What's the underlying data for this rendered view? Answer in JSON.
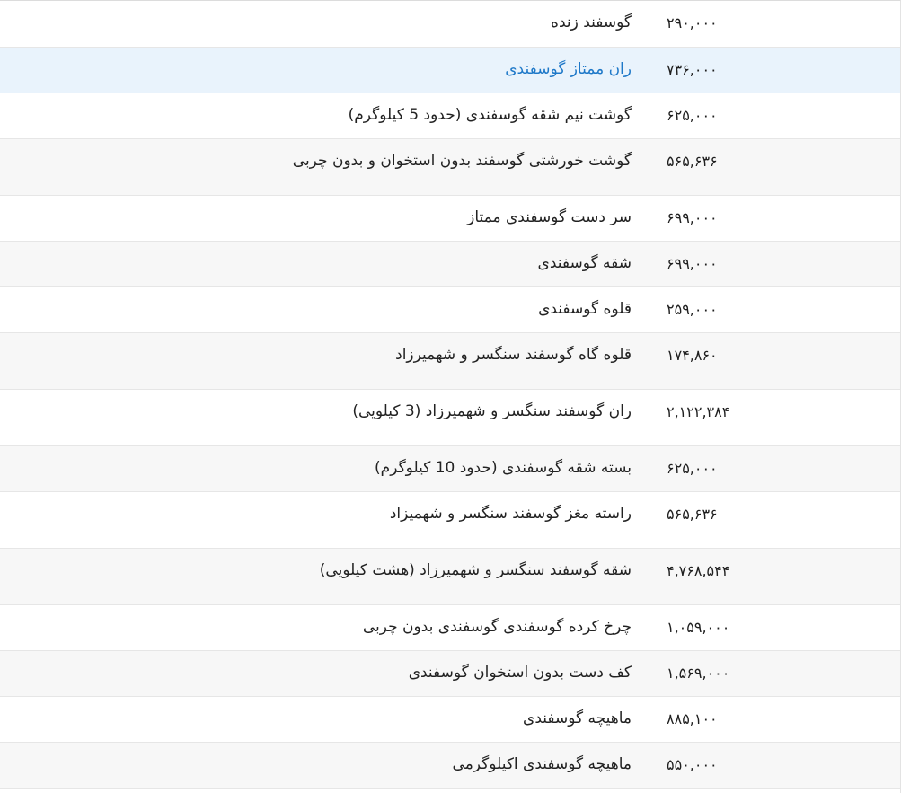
{
  "table": {
    "rows": [
      {
        "name": "گوسفند زنده",
        "price": "۲۹۰,۰۰۰"
      },
      {
        "name": "ران ممتاز گوسفندی",
        "price": "۷۳۶,۰۰۰"
      },
      {
        "name": "گوشت نیم شقه گوسفندی (حدود 5 کیلوگرم)",
        "price": "۶۲۵,۰۰۰"
      },
      {
        "name": "گوشت خورشتی گوسفند بدون استخوان و بدون چربی",
        "price": "۵۶۵,۶۳۶"
      },
      {
        "name": "سر دست گوسفندی ممتاز",
        "price": "۶۹۹,۰۰۰"
      },
      {
        "name": "شقه گوسفندی",
        "price": "۶۹۹,۰۰۰"
      },
      {
        "name": "قلوه گوسفندی",
        "price": "۲۵۹,۰۰۰"
      },
      {
        "name": "قلوه گاه گوسفند سنگسر و شهمیرزاد",
        "price": "۱۷۴,۸۶۰"
      },
      {
        "name": "ران گوسفند سنگسر و شهمیرزاد (3 کیلویی)",
        "price": "۲,۱۲۲,۳۸۴"
      },
      {
        "name": "بسته شقه گوسفندی (حدود 10 کیلوگرم)",
        "price": "۶۲۵,۰۰۰"
      },
      {
        "name": "راسته مغز گوسفند سنگسر و شهمیزاد",
        "price": "۵۶۵,۶۳۶"
      },
      {
        "name": "شقه گوسفند سنگسر و شهمیرزاد (هشت کیلویی)",
        "price": "۴,۷۶۸,۵۴۴"
      },
      {
        "name": "چرخ کرده گوسفندی گوسفندی بدون چربی",
        "price": "۱,۰۵۹,۰۰۰"
      },
      {
        "name": "کف دست بدون استخوان گوسفندی",
        "price": "۱,۵۶۹,۰۰۰"
      },
      {
        "name": "ماهیچه گوسفندی",
        "price": "۸۸۵,۱۰۰"
      },
      {
        "name": "ماهیچه گوسفندی اکیلوگرمی",
        "price": "۵۵۰,۰۰۰"
      }
    ]
  }
}
